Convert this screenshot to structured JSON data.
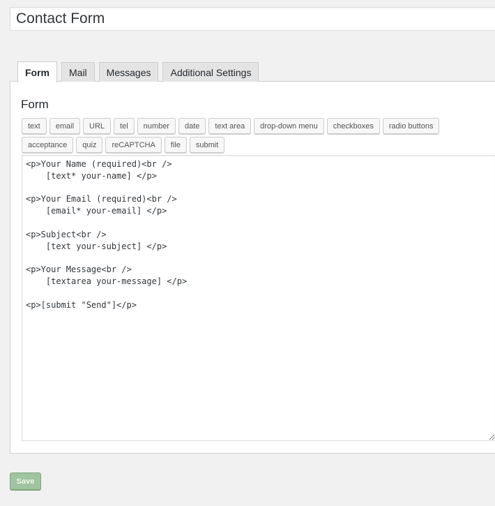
{
  "header": {
    "title_value": "Contact Form"
  },
  "tabs": [
    {
      "label": "Form",
      "active": true
    },
    {
      "label": "Mail",
      "active": false
    },
    {
      "label": "Messages",
      "active": false
    },
    {
      "label": "Additional Settings",
      "active": false
    }
  ],
  "form_panel": {
    "heading": "Form",
    "tag_buttons": [
      "text",
      "email",
      "URL",
      "tel",
      "number",
      "date",
      "text area",
      "drop-down menu",
      "checkboxes",
      "radio buttons",
      "acceptance",
      "quiz",
      "reCAPTCHA",
      "file",
      "submit"
    ],
    "template_code": "<p>Your Name (required)<br />\n    [text* your-name] </p>\n\n<p>Your Email (required)<br />\n    [email* your-email] </p>\n\n<p>Subject<br />\n    [text your-subject] </p>\n\n<p>Your Message<br />\n    [textarea your-message] </p>\n\n<p>[submit \"Send\"]</p>"
  },
  "footer": {
    "save_label": "Save"
  },
  "colors": {
    "background": "#f1f1f1",
    "panel": "#ffffff",
    "border": "#cccccc",
    "save_button": "#9fc49f"
  }
}
